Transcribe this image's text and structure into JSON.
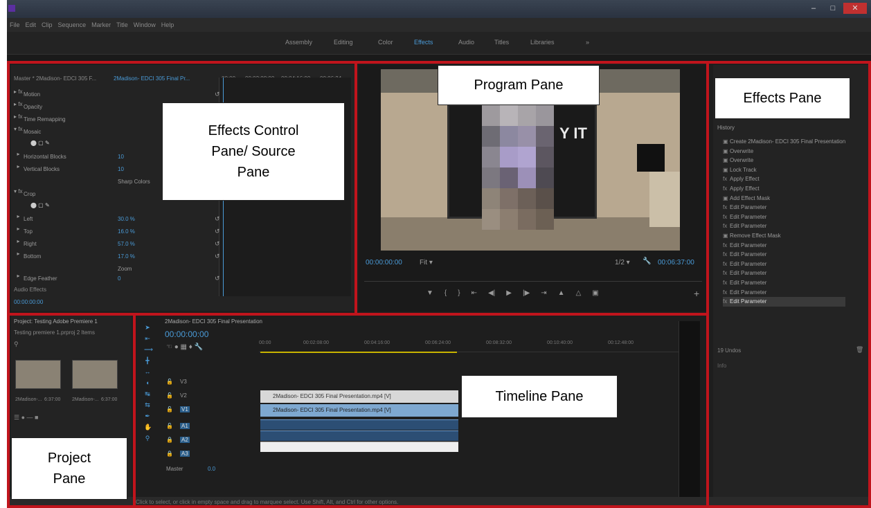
{
  "menu": [
    "File",
    "Edit",
    "Clip",
    "Sequence",
    "Marker",
    "Title",
    "Window",
    "Help"
  ],
  "workspaces": [
    {
      "label": "Assembly",
      "active": false
    },
    {
      "label": "Editing",
      "active": false
    },
    {
      "label": "Color",
      "active": false
    },
    {
      "label": "Effects",
      "active": true
    },
    {
      "label": "Audio",
      "active": false
    },
    {
      "label": "Titles",
      "active": false
    },
    {
      "label": "Libraries",
      "active": false
    }
  ],
  "effect_controls": {
    "master": "Master * 2Madison- EDCI 305 F...",
    "clip": "2Madison- EDCI 305 Final Pr...",
    "timecodes": [
      "00:00",
      "00:02:08:00",
      "00:04:16:00",
      "00:06:24"
    ],
    "rows": [
      {
        "name": "Motion",
        "value": ""
      },
      {
        "name": "Opacity",
        "value": ""
      },
      {
        "name": "Time Remapping",
        "value": ""
      },
      {
        "name": "Mosaic",
        "value": ""
      },
      {
        "name": "",
        "value": ""
      },
      {
        "name": "Horizontal Blocks",
        "value": "10"
      },
      {
        "name": "Vertical Blocks",
        "value": "10"
      },
      {
        "name": "",
        "value": "Sharp Colors"
      },
      {
        "name": "Crop",
        "value": ""
      },
      {
        "name": "",
        "value": ""
      },
      {
        "name": "Left",
        "value": "30.0 %"
      },
      {
        "name": "Top",
        "value": "16.0 %"
      },
      {
        "name": "Right",
        "value": "57.0 %"
      },
      {
        "name": "Bottom",
        "value": "17.0 %"
      },
      {
        "name": "",
        "value": "Zoom"
      },
      {
        "name": "Edge Feather",
        "value": "0"
      }
    ],
    "audio_effects": "Audio Effects",
    "footer_time": "00:00:00:00"
  },
  "program": {
    "video_text": "Y IT",
    "timecode_left": "00:00:00:00",
    "fit": "Fit",
    "quality": "1/2",
    "timecode_right": "00:06:37:00"
  },
  "effects_panel": {
    "history_title": "History",
    "history_items": [
      "Create 2Madison- EDCI 305 Final Presentation",
      "Overwrite",
      "Overwrite",
      "Lock Track",
      "Apply Effect",
      "Apply Effect",
      "Add Effect Mask",
      "Edit Parameter",
      "Edit Parameter",
      "Edit Parameter",
      "Remove Effect Mask",
      "Edit Parameter",
      "Edit Parameter",
      "Edit Parameter",
      "Edit Parameter",
      "Edit Parameter",
      "Edit Parameter",
      "Edit Parameter"
    ],
    "undo_label": "19 Undos",
    "info_label": "Info"
  },
  "project": {
    "title": "Project: Testing Adobe Premiere 1",
    "path": "Testing premiere 1.prproj   2 Items",
    "items": [
      "2Madison-...",
      "2Madison-..."
    ],
    "durations": [
      "6:37:00",
      "6:37:00"
    ]
  },
  "timeline": {
    "sequence_tab": "2Madison- EDCI 305 Final Presentation",
    "timecode": "00:00:00:00",
    "ruler": [
      "00:00",
      "00:02:08:00",
      "00:04:16:00",
      "00:06:24:00",
      "00:08:32:00",
      "00:10:40:00",
      "00:12:48:00"
    ],
    "tracks": [
      "V3",
      "V2",
      "V1",
      "A1",
      "A2",
      "A3"
    ],
    "master_label": "Master",
    "master_value": "0.0",
    "clip_v2": "2Madison- EDCI 305 Final Presentation.mp4 [V]",
    "clip_v1": "2Madison- EDCI 305 Final Presentation.mp4 [V]"
  },
  "status": "Click to select, or click in empty space and drag to marquee select. Use Shift, Alt, and Ctrl for other options.",
  "labels": {
    "effects_control": [
      "Effects Control",
      "Pane/ Source",
      "Pane"
    ],
    "program": "Program Pane",
    "effects": "Effects Pane",
    "project": [
      "Project",
      "Pane"
    ],
    "timeline": "Timeline Pane"
  }
}
